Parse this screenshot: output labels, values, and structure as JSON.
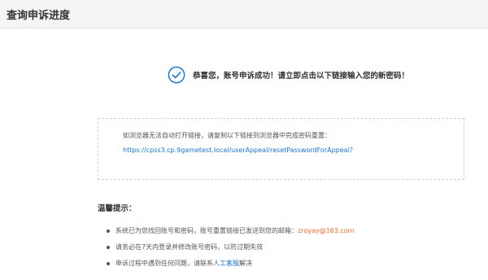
{
  "header": {
    "title": "查询申诉进度"
  },
  "success": {
    "icon": "check-circle-icon",
    "message": "恭喜您，账号申诉成功！请立即点击以下链接输入您的新密码！",
    "accent_color": "#1a73c8"
  },
  "link_box": {
    "instruction": "如浏览器无法自动打开链接，请复制以下链接到浏览器中完成密码重置：",
    "url": "https://cpss3.cp.9gametest.local/userAppeal/resetPasswordForAppeal?",
    "dots": ". ."
  },
  "tips": {
    "title": "温馨提示：",
    "items": [
      {
        "text": "系统已为您找回账号和密码，账号重置链接已发送到您的邮箱：",
        "email": "zroyay@163.com"
      },
      {
        "text": "请务必在7天内登录并修改账号密码，以防过期失效"
      },
      {
        "text_before": "申诉过程中遇到任何问题，请联系人",
        "link": "工客服",
        "text_after": "解决"
      }
    ]
  }
}
